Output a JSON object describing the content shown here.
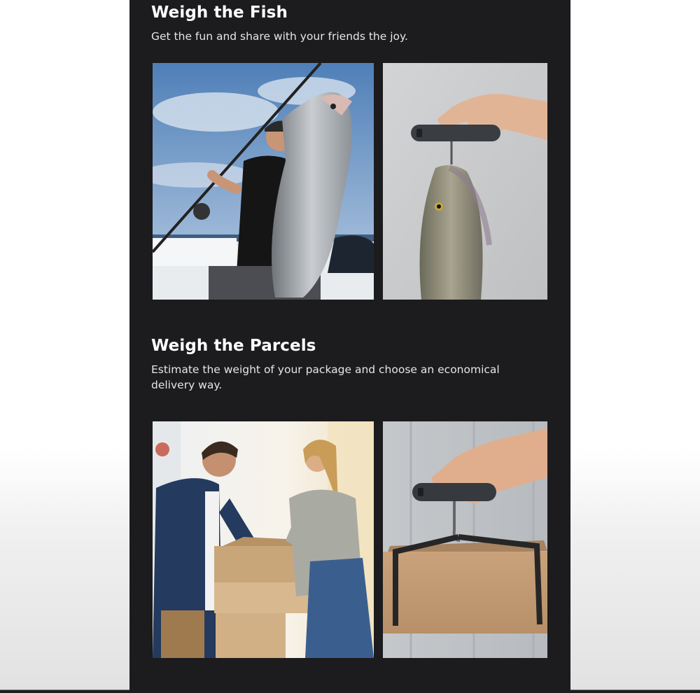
{
  "sections": [
    {
      "title": "Weigh the Fish",
      "subtitle": "Get the fun and share with your friends the joy."
    },
    {
      "title": "Weigh the Parcels",
      "subtitle": "Estimate the weight of your package and choose an economical delivery way."
    }
  ],
  "colors": {
    "panel": "#1c1b1d",
    "heading": "#ffffff",
    "subtitle": "#e6e6e6"
  }
}
